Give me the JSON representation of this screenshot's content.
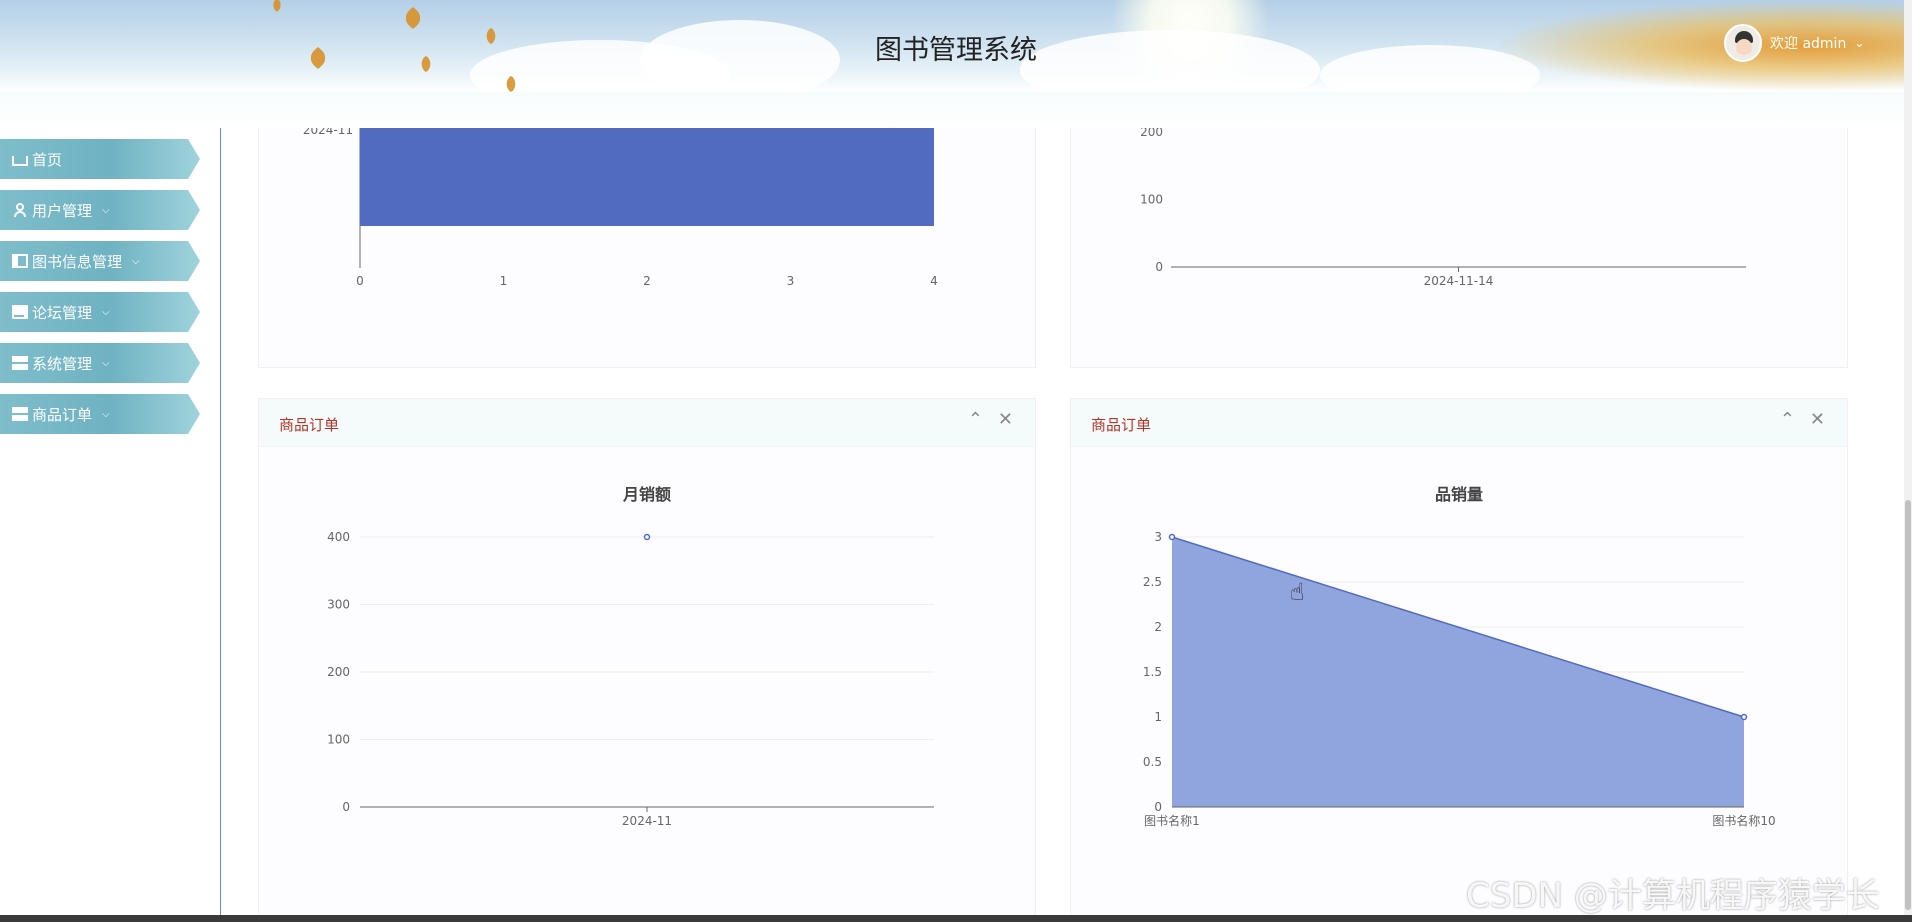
{
  "header": {
    "title": "图书管理系统",
    "user_greeting": "欢迎 admin",
    "user_caret": "⌄"
  },
  "sidebar": {
    "items": [
      {
        "label": "首页",
        "icon": "home-icon"
      },
      {
        "label": "用户管理",
        "icon": "user-icon"
      },
      {
        "label": "图书信息管理",
        "icon": "book-icon"
      },
      {
        "label": "论坛管理",
        "icon": "forum-icon"
      },
      {
        "label": "系统管理",
        "icon": "settings-icon"
      },
      {
        "label": "商品订单",
        "icon": "grid-icon"
      }
    ]
  },
  "cards": {
    "bottom_left": {
      "title": "商品订单",
      "collapse": "⌃",
      "close": "✕",
      "chart_title": "月销额"
    },
    "bottom_right": {
      "title": "商品订单",
      "collapse": "⌃",
      "close": "✕",
      "chart_title": "品销量"
    }
  },
  "chart_data": [
    {
      "type": "bar",
      "orientation": "horizontal",
      "categories": [
        "2024-11"
      ],
      "values": [
        4
      ],
      "xlim": [
        0,
        4
      ],
      "x_ticks": [
        "0",
        "1",
        "2",
        "3",
        "4"
      ],
      "color": "#516bc1"
    },
    {
      "type": "bar",
      "categories": [
        "2024-11-14"
      ],
      "y_ticks": [
        "0",
        "100",
        "200"
      ],
      "ylim": [
        0,
        200
      ]
    },
    {
      "type": "line",
      "title": "月销额",
      "categories": [
        "2024-11"
      ],
      "values": [
        400
      ],
      "ylim": [
        0,
        400
      ],
      "y_ticks": [
        "0",
        "100",
        "200",
        "300",
        "400"
      ],
      "color": "#516bc1"
    },
    {
      "type": "area",
      "title": "品销量",
      "categories": [
        "图书名称1",
        "图书名称10"
      ],
      "values": [
        3,
        1
      ],
      "ylim": [
        0,
        3
      ],
      "y_ticks": [
        "0",
        "0.5",
        "1",
        "1.5",
        "2",
        "2.5",
        "3"
      ],
      "color": "#516bc1",
      "fill": "#8a9fdc"
    }
  ],
  "watermark": "CSDN @计算机程序猿学长"
}
